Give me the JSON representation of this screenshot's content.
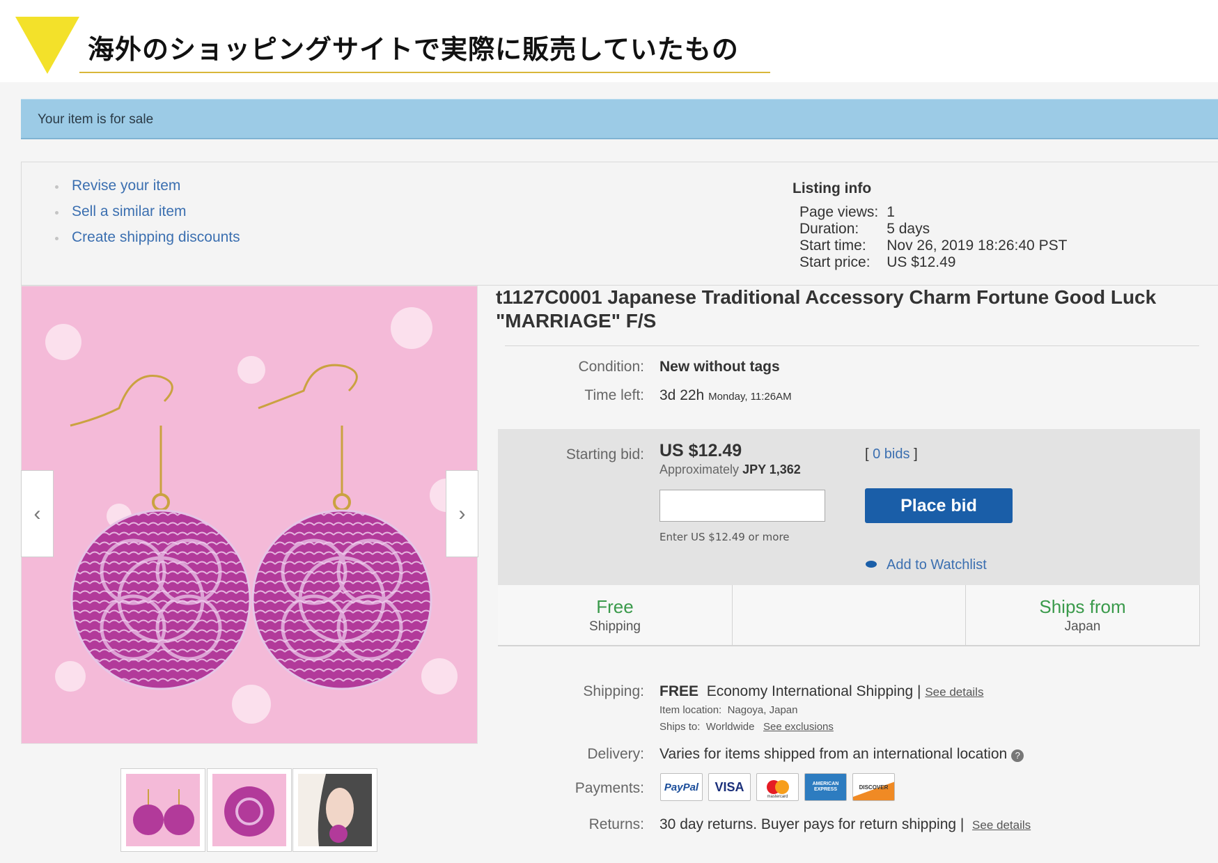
{
  "header": {
    "title": "海外のショッピングサイトで実際に販売していたもの",
    "accent_color": "#f3e12a"
  },
  "banner": {
    "text": "Your item is for sale",
    "color": "#9ccbe6"
  },
  "actions": {
    "revise": "Revise your item",
    "sell_similar": "Sell a similar item",
    "shipping_discounts": "Create shipping discounts"
  },
  "listing_info": {
    "heading": "Listing info",
    "rows": [
      {
        "label": "Page views:",
        "value": "1"
      },
      {
        "label": "Duration:",
        "value": "5 days"
      },
      {
        "label": "Start time:",
        "value": "Nov 26, 2019 18:26:40 PST"
      },
      {
        "label": "Start price:",
        "value": "US $12.49"
      }
    ]
  },
  "product": {
    "title": "t1127C0001 Japanese Traditional Accessory Charm Fortune Good Luck \"MARRIAGE\" F/S",
    "condition_label": "Condition:",
    "condition": "New without tags",
    "time_left_label": "Time left:",
    "time_left": "3d 22h",
    "time_left_detail": "Monday, 11:26AM"
  },
  "bid": {
    "label": "Starting bid:",
    "price": "US $12.49",
    "approx_prefix": "Approximately",
    "approx_value": "JPY 1,362",
    "bids_open": "[",
    "bids_count": "0 bids",
    "bids_close": "]",
    "input_hint": "Enter US $12.49 or more",
    "place_bid": "Place bid",
    "watchlist": "Add to Watchlist",
    "button_color": "#1a5ea8"
  },
  "features": {
    "free": "Free",
    "shipping": "Shipping",
    "ships_from": "Ships from",
    "country": "Japan",
    "accent_color": "#3a9a4b"
  },
  "details": {
    "shipping_label": "Shipping:",
    "shipping_free": "FREE",
    "shipping_value": "Economy International Shipping |",
    "shipping_see_details": "See details",
    "item_location_label": "Item location:",
    "item_location": "Nagoya, Japan",
    "ships_to_label": "Ships to:",
    "ships_to": "Worldwide",
    "see_exclusions": "See exclusions",
    "delivery_label": "Delivery:",
    "delivery_value": "Varies for items shipped from an international location",
    "payments_label": "Payments:",
    "payment_methods": [
      "PayPal",
      "VISA",
      "mastercard",
      "AMERICAN EXPRESS",
      "DISCOVER"
    ],
    "returns_label": "Returns:",
    "returns_value": "30 day returns. Buyer pays for return shipping |",
    "returns_see_details": "See details"
  },
  "icons": [
    "chevron-left-icon",
    "chevron-right-icon",
    "eye-icon",
    "help-icon"
  ]
}
